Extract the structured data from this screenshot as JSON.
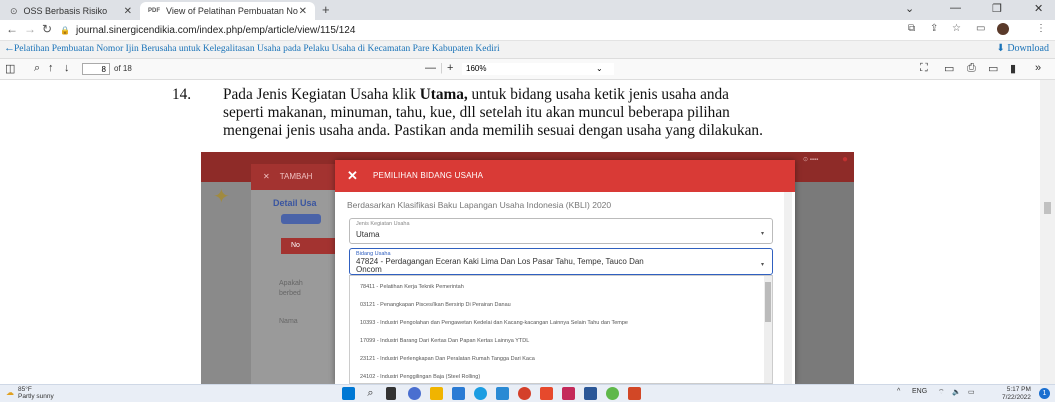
{
  "browser": {
    "tabs": [
      {
        "label": "OSS Berbasis Risiko",
        "icon": "globe-icon",
        "active": false
      },
      {
        "label": "View of Pelatihan Pembuatan No",
        "icon": "pdf-icon",
        "active": true
      }
    ],
    "new_tab": "+",
    "url": "journal.sinergicendikia.com/index.php/emp/article/view/115/124"
  },
  "pdf": {
    "title": "Pelatihan Pembuatan Nomor Ijin Berusaha untuk Kelegalitasan Usaha pada Pelaku Usaha di Kecamatan Pare Kabupaten Kediri",
    "download_label": "Download",
    "page_current": "8",
    "page_total": "of 18",
    "zoom": "160%"
  },
  "document": {
    "item_number": "14.",
    "line1_pre": "Pada Jenis Kegiatan Usaha klik ",
    "line1_bold": "Utama,",
    "line1_post": " untuk bidang usaha ketik jenis usaha anda",
    "line2": "seperti makanan, minuman, tahu, kue, dll setelah itu akan muncul beberapa pilihan",
    "line3": "mengenai jenis usaha anda. Pastikan anda memilih sesuai dengan usaha yang dilakukan."
  },
  "screenshot": {
    "bg_header": "TAMBAH",
    "bg_detail": "Detail Usa",
    "bg_red_label": "No",
    "bg_text1": "Apakah",
    "bg_text2": "berbed",
    "bg_text3": "Nama",
    "dialog_title": "PEMILIHAN BIDANG USAHA",
    "dialog_subtitle": "Berdasarkan Klasifikasi Baku Lapangan Usaha Indonesia (KBLI) 2020",
    "field1_label": "Jenis Kegiatan Usaha",
    "field1_value": "Utama",
    "field2_label": "Bidang Usaha",
    "field2_value_line1": "47824 - Perdagangan Eceran Kaki Lima Dan Los Pasar Tahu, Tempe, Tauco Dan",
    "field2_value_line2": "Oncom",
    "options": [
      "78411 - Pelatihan Kerja Teknik Pemerintah",
      "03121 - Penangkapan Pisces/Ikan Bersirip Di Perairan Danau",
      "10393 - Industri Pengolahan dan Pengawetan Kedelai dan Kacang-kacangan Lainnya Selain Tahu dan Tempe",
      "17099 - Industri Barang Dari Kertas Dan Papan Kertas Lainnya YTDL",
      "23121 - Industri Perlengkapan Dan Peralatan Rumah Tangga Dari Kaca",
      "24102 - Industri Penggilingan Baja (Steel Rolling)"
    ]
  },
  "taskbar": {
    "temp": "85°F",
    "condition": "Partly sunny",
    "lang": "ENG",
    "time": "5:17 PM",
    "date": "7/22/2022",
    "notif_count": "1"
  }
}
